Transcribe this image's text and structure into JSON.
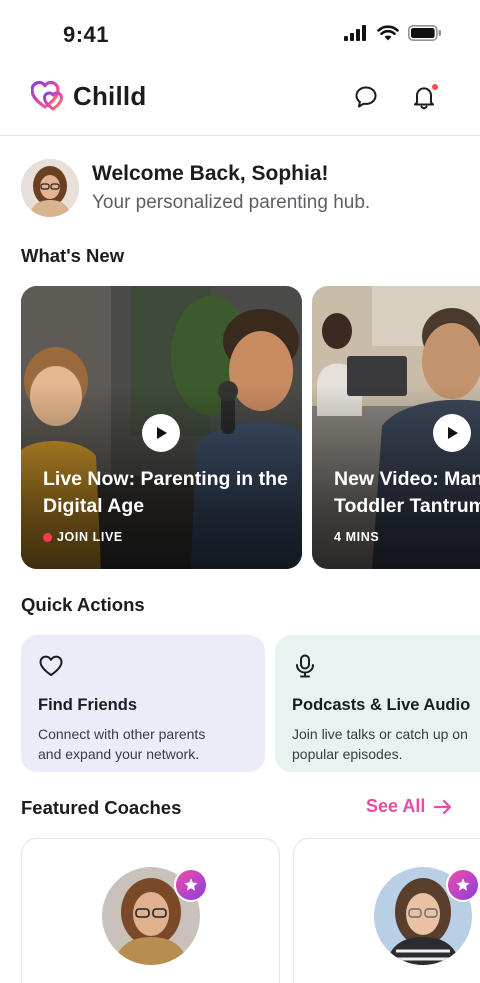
{
  "status_bar": {
    "time": "9:41"
  },
  "header": {
    "app_name": "Chilld",
    "brand_color": "#e94ba2"
  },
  "welcome": {
    "title": "Welcome Back, Sophia!",
    "subtitle": "Your personalized parenting hub."
  },
  "whats_new": {
    "title": "What's New",
    "cards": [
      {
        "title_line1": "Live Now: Parenting in the",
        "title_line2": "Digital Age",
        "meta": "JOIN LIVE",
        "live": true
      },
      {
        "title_line1": "New Video: Managing",
        "title_line2": "Toddler Tantrums",
        "meta": "4 MINS",
        "live": false
      }
    ]
  },
  "quick_actions": {
    "title": "Quick Actions",
    "cards": [
      {
        "icon": "heart-icon",
        "title": "Find Friends",
        "desc_line1": "Connect with other parents",
        "desc_line2": "and expand your network.",
        "bg": "#eaedf8"
      },
      {
        "icon": "microphone-icon",
        "title": "Podcasts & Live Audio",
        "desc_line1": "Join live talks or catch up on",
        "desc_line2": "popular episodes.",
        "bg": "#e8f3f1"
      }
    ]
  },
  "featured_coaches": {
    "title": "Featured Coaches",
    "see_all": "See All"
  }
}
